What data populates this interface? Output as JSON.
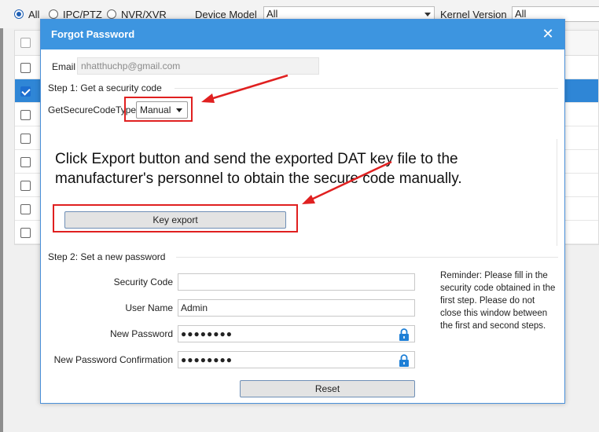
{
  "filters": {
    "radio_all": "All",
    "radio_ipc": "IPC/PTZ",
    "radio_nvr": "NVR/XVR",
    "device_model_label": "Device Model",
    "device_model_value": "All",
    "kernel_version_label": "Kernel Version",
    "kernel_version_value": "All"
  },
  "dialog": {
    "title": "Forgot Password",
    "close_icon": "close-icon",
    "email_label": "Email",
    "email_value": "nhatthuchp@gmail.com",
    "step1_title": "Step 1: Get a security code",
    "code_type_label": "GetSecureCodeType",
    "code_type_value": "Manual",
    "annotation_text": "Click Export button and send the exported DAT key file to the manufacturer's personnel to obtain the secure code manually.",
    "key_export_label": "Key export",
    "step2_title": "Step 2: Set a new password",
    "security_code_label": "Security Code",
    "security_code_value": "",
    "user_name_label": "User Name",
    "user_name_value": "Admin",
    "new_password_label": "New Password",
    "new_password_value": "●●●●●●●●",
    "confirm_label": "New Password Confirmation",
    "confirm_value": "●●●●●●●●",
    "reminder": "Reminder: Please fill in the security code obtained in the first step. Please do not close this window between the first and second steps.",
    "reset_label": "Reset",
    "lock_icon": "lock-icon"
  },
  "colors": {
    "titlebar": "#3d95e0",
    "highlight": "#e02020",
    "selected_row": "#2f86d6"
  }
}
